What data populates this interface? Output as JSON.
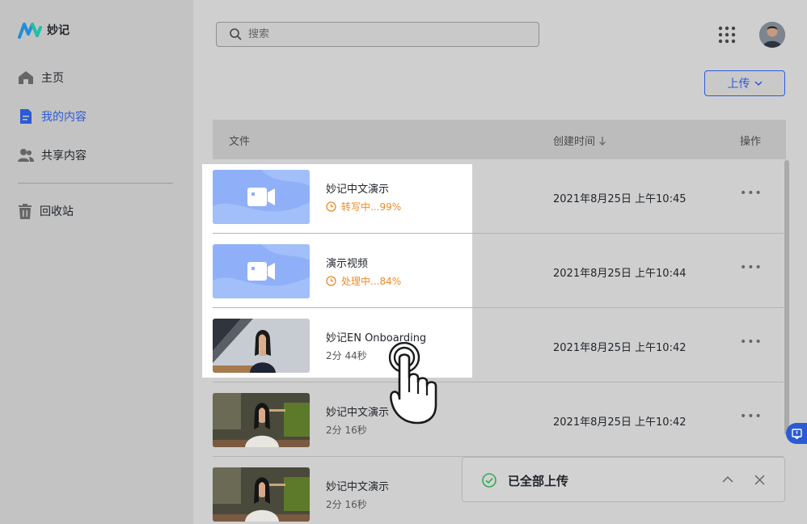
{
  "app": {
    "name": "妙记"
  },
  "sidebar": {
    "items": [
      {
        "label": "主页",
        "icon": "home-icon"
      },
      {
        "label": "我的内容",
        "icon": "document-icon",
        "active": true
      },
      {
        "label": "共享内容",
        "icon": "people-icon"
      },
      {
        "label": "回收站",
        "icon": "trash-icon"
      }
    ]
  },
  "search": {
    "placeholder": "搜索"
  },
  "upload": {
    "label": "上传"
  },
  "table": {
    "headers": {
      "file": "文件",
      "created": "创建时间",
      "actions": "操作"
    },
    "rows": [
      {
        "title": "妙记中文演示",
        "status": "转写中...99%",
        "date": "2021年8月25日 上午10:45",
        "thumb": "video-placeholder"
      },
      {
        "title": "演示视频",
        "status": "处理中...84%",
        "date": "2021年8月25日 上午10:44",
        "thumb": "video-placeholder"
      },
      {
        "title": "妙记EN Onboarding",
        "duration": "2分 44秒",
        "date": "2021年8月25日 上午10:42",
        "thumb": "person-office"
      },
      {
        "title": "妙记中文演示",
        "duration": "2分 16秒",
        "date": "2021年8月25日 上午10:42",
        "thumb": "person-office"
      },
      {
        "title": "妙记中文演示",
        "duration": "2分 16秒",
        "thumb": "person-office"
      }
    ]
  },
  "toast": {
    "message": "已全部上传"
  },
  "colors": {
    "accent": "#2a5bd7",
    "processing": "#f08a24",
    "success": "#34a853"
  }
}
